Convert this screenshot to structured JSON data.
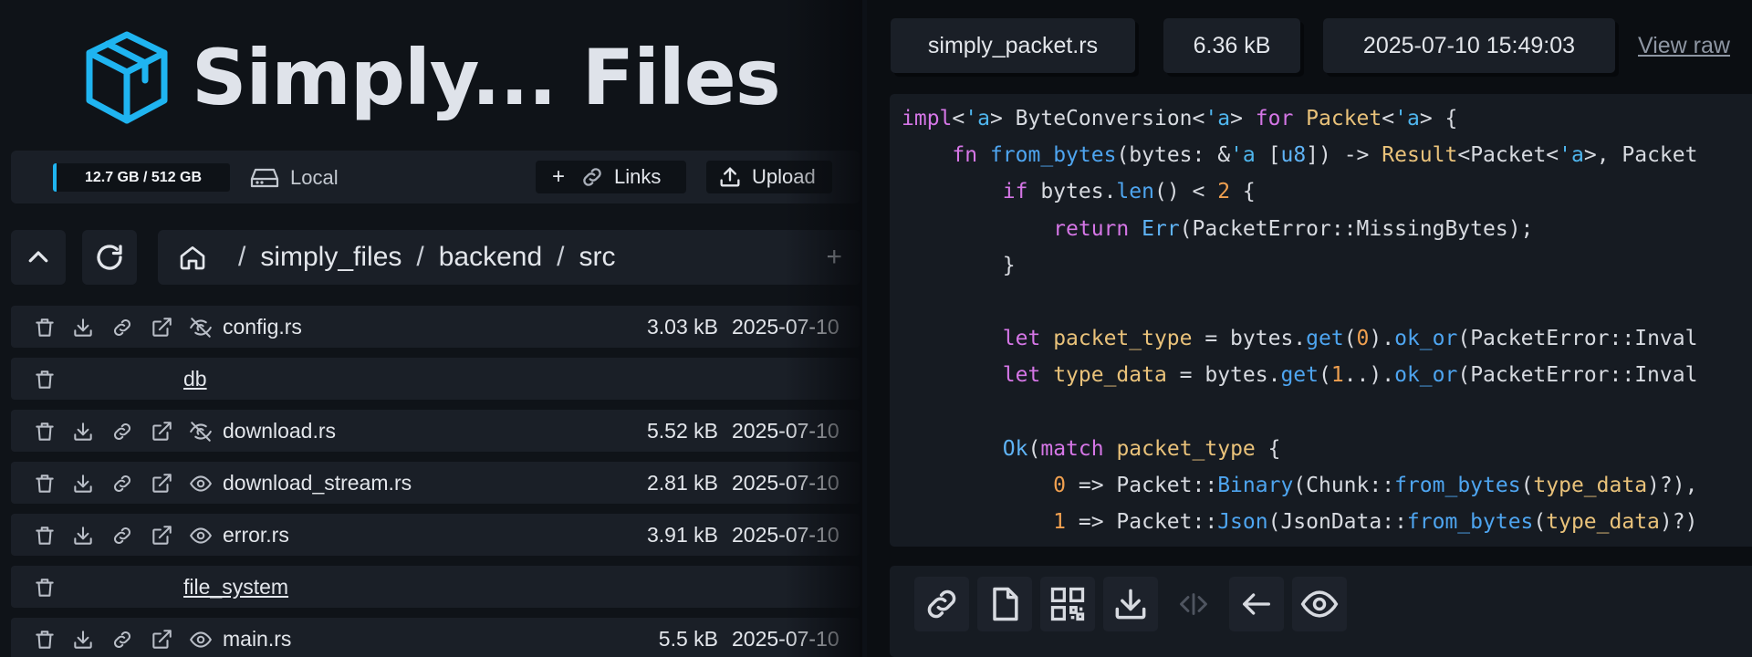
{
  "app": {
    "title": "Simply... Files"
  },
  "toolbar": {
    "storage": "12.7 GB / 512 GB",
    "location": "Local",
    "links_plus": "+",
    "links_label": "Links",
    "upload_label": "Upload"
  },
  "breadcrumb": {
    "segments": [
      "simply_files",
      "backend",
      "src"
    ],
    "separator": "/",
    "add": "+"
  },
  "files": [
    {
      "type": "file",
      "name": "config.rs",
      "size": "3.03 kB",
      "date": "2025-07-10",
      "visibility": "eye-off-icon"
    },
    {
      "type": "dir",
      "name": "db"
    },
    {
      "type": "file",
      "name": "download.rs",
      "size": "5.52 kB",
      "date": "2025-07-10",
      "visibility": "eye-off-icon"
    },
    {
      "type": "file",
      "name": "download_stream.rs",
      "size": "2.81 kB",
      "date": "2025-07-10",
      "visibility": "eye-icon"
    },
    {
      "type": "file",
      "name": "error.rs",
      "size": "3.91 kB",
      "date": "2025-07-10",
      "visibility": "eye-icon"
    },
    {
      "type": "dir",
      "name": "file_system"
    },
    {
      "type": "file",
      "name": "main.rs",
      "size": "5.5 kB",
      "date": "2025-07-10",
      "visibility": "eye-icon"
    }
  ],
  "preview": {
    "filename": "simply_packet.rs",
    "size": "6.36 kB",
    "modified": "2025-07-10 15:49:03",
    "view_raw": "View raw"
  },
  "code_lines": [
    "impl<'a> ByteConversion<'a> for Packet<'a> {",
    "    fn from_bytes(bytes: &'a [u8]) -> Result<Packet<'a>, Packet",
    "        if bytes.len() < 2 {",
    "            return Err(PacketError::MissingBytes);",
    "        }",
    "",
    "        let packet_type = bytes.get(0).ok_or(PacketError::Inval",
    "        let type_data = bytes.get(1..).ok_or(PacketError::Inval",
    "",
    "        Ok(match packet_type {",
    "            0 => Packet::Binary(Chunk::from_bytes(type_data)?),",
    "            1 => Packet::Json(JsonData::from_bytes(type_data)?)"
  ],
  "colors": {
    "accent": "#1fb4f0",
    "panel": "#1a1f27",
    "background": "#0f1318"
  }
}
